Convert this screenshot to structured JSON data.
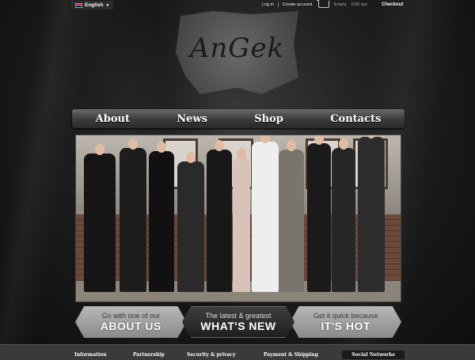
{
  "topbar": {
    "language": "English",
    "links": [
      "Log in",
      "Create account"
    ],
    "cart_status": "Empty",
    "cart_total": "0.00 грн",
    "checkout": "Checkout"
  },
  "logo": {
    "text": "AnGek"
  },
  "nav": {
    "items": [
      "About",
      "News",
      "Shop",
      "Contacts"
    ]
  },
  "banners": [
    {
      "small": "Go with one of our",
      "big": "ABOUT US"
    },
    {
      "small": "The latest & greatest",
      "big": "WHAT'S NEW"
    },
    {
      "small": "Get it quick because",
      "big": "IT'S HOT"
    }
  ],
  "footer": {
    "items": [
      "Information",
      "Partnership",
      "Security & privacy",
      "Payment & Shipping"
    ],
    "social": "Social Networks"
  },
  "colors": {
    "background": "#141414",
    "nav": "#3a3a3a",
    "banner_dark": "#1f1f1f",
    "banner_light": "#a0a0a0"
  }
}
